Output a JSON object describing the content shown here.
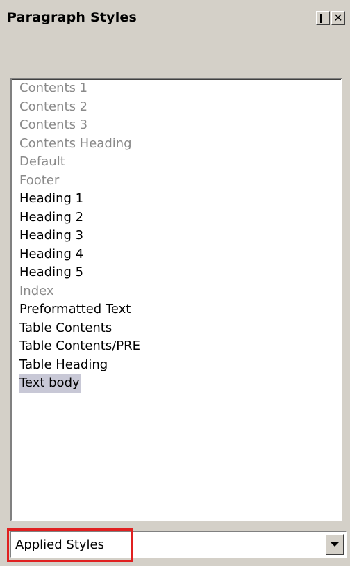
{
  "window": {
    "title": "Paragraph Styles",
    "minimize_icon": "minimize-icon",
    "close_symbol": "✕"
  },
  "toolbar": {
    "buttons": [
      {
        "name": "paragraph-styles-icon",
        "pressed": true
      },
      {
        "name": "character-styles-icon",
        "pressed": false
      },
      {
        "name": "frame-styles-icon",
        "pressed": false
      },
      {
        "name": "page-styles-icon",
        "pressed": false
      },
      {
        "name": "list-styles-icon",
        "pressed": false
      },
      {
        "name": "fill-format-mode-icon",
        "pressed": false
      },
      {
        "name": "new-style-from-selection-icon",
        "pressed": false
      },
      {
        "name": "update-style-icon",
        "pressed": false
      }
    ]
  },
  "styles": {
    "items": [
      {
        "label": "Contents 1",
        "state": "unused"
      },
      {
        "label": "Contents 2",
        "state": "unused"
      },
      {
        "label": "Contents 3",
        "state": "unused"
      },
      {
        "label": "Contents Heading",
        "state": "unused"
      },
      {
        "label": "Default",
        "state": "unused"
      },
      {
        "label": "Footer",
        "state": "unused"
      },
      {
        "label": "Heading 1",
        "state": "used"
      },
      {
        "label": "Heading 2",
        "state": "used"
      },
      {
        "label": "Heading 3",
        "state": "used"
      },
      {
        "label": "Heading 4",
        "state": "used"
      },
      {
        "label": "Heading 5",
        "state": "used"
      },
      {
        "label": "Index",
        "state": "unused"
      },
      {
        "label": "Preformatted Text",
        "state": "used"
      },
      {
        "label": "Table Contents",
        "state": "used"
      },
      {
        "label": "Table Contents/PRE",
        "state": "used"
      },
      {
        "label": "Table Heading",
        "state": "used"
      },
      {
        "label": "Text body",
        "state": "selected"
      }
    ]
  },
  "filter": {
    "selected": "Applied Styles",
    "highlight_color": "#e02020"
  },
  "colors": {
    "face": "#d4d0c8",
    "unused_text": "#8a8a8a",
    "selection": "#c8c8d6"
  }
}
